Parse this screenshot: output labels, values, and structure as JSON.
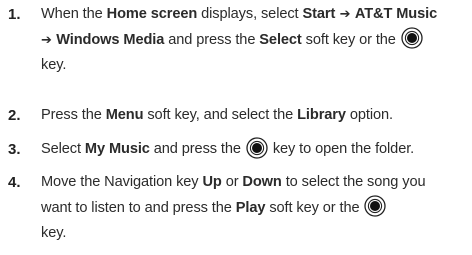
{
  "steps": [
    {
      "number": "1.",
      "parts": [
        {
          "t": "When the "
        },
        {
          "b": "Home screen"
        },
        {
          "t": " displays, select "
        },
        {
          "b": "Start"
        },
        {
          "arrow": "➔"
        },
        {
          "b": "AT&T Music"
        },
        {
          "br": true
        },
        {
          "arrow": "➔"
        },
        {
          "b": "Windows Media"
        },
        {
          "t": " and press the "
        },
        {
          "b": "Select"
        },
        {
          "t": " soft key or the "
        },
        {
          "icon": "select-key-icon"
        },
        {
          "br": true
        },
        {
          "t": "key."
        }
      ]
    },
    {
      "number": "2.",
      "parts": [
        {
          "t": "Press the "
        },
        {
          "b": "Menu"
        },
        {
          "t": " soft key, and select the "
        },
        {
          "b": "Library"
        },
        {
          "t": " option."
        }
      ]
    },
    {
      "number": "3.",
      "parts": [
        {
          "t": "Select "
        },
        {
          "b": "My Music"
        },
        {
          "t": " and press the "
        },
        {
          "icon": "select-key-icon"
        },
        {
          "t": " key to open the folder."
        }
      ]
    },
    {
      "number": "4.",
      "parts": [
        {
          "t": "Move the Navigation key "
        },
        {
          "b": "Up"
        },
        {
          "t": " or "
        },
        {
          "b": "Down"
        },
        {
          "t": " to select the song you"
        },
        {
          "br": true
        },
        {
          "t": "want to listen to and press the "
        },
        {
          "b": "Play"
        },
        {
          "t": " soft key or the "
        },
        {
          "icon": "select-key-icon"
        },
        {
          "br": true
        },
        {
          "t": "key."
        }
      ]
    }
  ]
}
